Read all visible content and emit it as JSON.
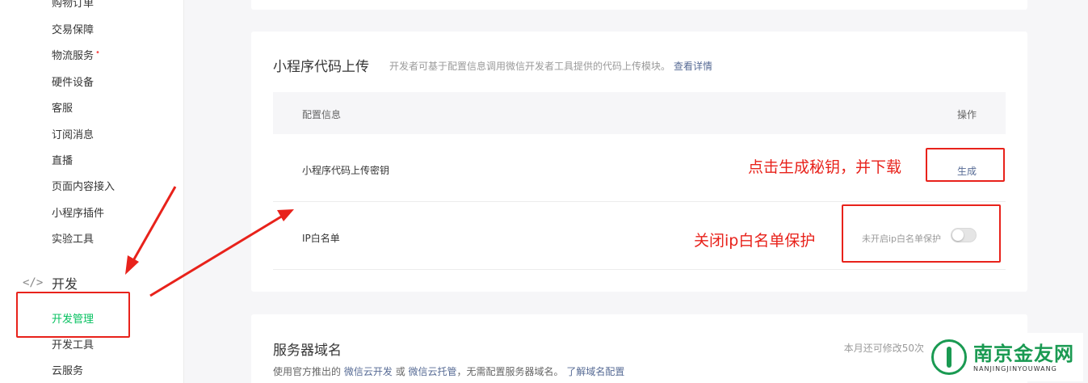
{
  "sidebar": {
    "items": [
      {
        "label": "购物订单"
      },
      {
        "label": "交易保障"
      },
      {
        "label": "物流服务",
        "badge": "•"
      },
      {
        "label": "硬件设备"
      },
      {
        "label": "客服"
      },
      {
        "label": "订阅消息"
      },
      {
        "label": "直播"
      },
      {
        "label": "页面内容接入"
      },
      {
        "label": "小程序插件"
      },
      {
        "label": "实验工具"
      }
    ],
    "section": {
      "icon": "code-icon",
      "icon_glyph": "</>",
      "label": "开发"
    },
    "sub_items": [
      {
        "label": "开发管理",
        "active": true
      },
      {
        "label": "开发工具"
      },
      {
        "label": "云服务"
      }
    ]
  },
  "upload_card": {
    "title": "小程序代码上传",
    "description": "开发者可基于配置信息调用微信开发者工具提供的代码上传模块。",
    "detail_link": "查看详情",
    "table_header": {
      "config": "配置信息",
      "action": "操作"
    },
    "rows": {
      "secret": {
        "label": "小程序代码上传密钥",
        "action": "生成"
      },
      "ip_whitelist": {
        "label": "IP白名单",
        "status": "未开启ip白名单保护",
        "toggle_on": false
      }
    }
  },
  "server_card": {
    "title": "服务器域名",
    "quota": "本月还可修改50次",
    "desc_prefix": "使用官方推出的",
    "link_cloud_dev": "微信云开发",
    "desc_or": "或",
    "link_cloud_host": "微信云托管",
    "desc_suffix": "，无需配置服务器域名。",
    "link_learn": "了解域名配置"
  },
  "annotations": {
    "generate_note": "点击生成秘钥，并下载",
    "ip_note": "关闭ip白名单保护",
    "color": "#e8221b"
  },
  "watermark": {
    "cn": "南京金友网",
    "en": "NANJINGJINYOUWANG"
  },
  "colors": {
    "accent_green": "#07c160",
    "link_blue": "#576b95",
    "annotation_red": "#e8221b"
  }
}
